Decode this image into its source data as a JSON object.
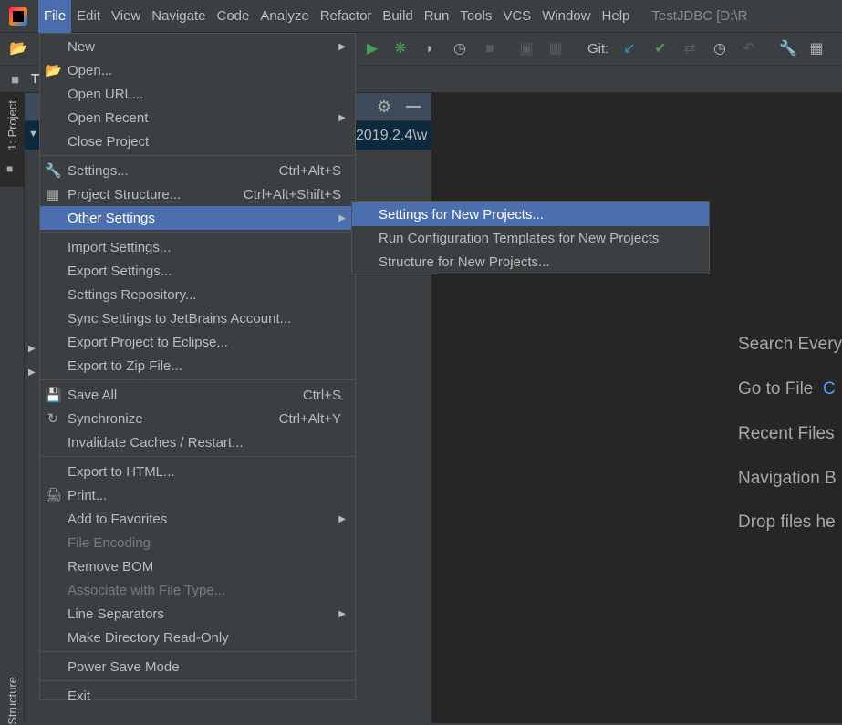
{
  "menubar": {
    "items": [
      "File",
      "Edit",
      "View",
      "Navigate",
      "Code",
      "Analyze",
      "Refactor",
      "Build",
      "Run",
      "Tools",
      "VCS",
      "Window",
      "Help"
    ],
    "active": "File",
    "window_title": "TestJDBC [D:\\R"
  },
  "toolbar": {
    "git_label": "Git:",
    "accent_green": "#499c54",
    "accent_blue": "#3592c4"
  },
  "navbar": {
    "crumb": "T"
  },
  "left_strip": {
    "project_tab": "1: Project",
    "structure_tab": "Structure"
  },
  "project_panel": {
    "path_fragment": "2019.2.4\\w"
  },
  "editor": {
    "hints": [
      "Search Every",
      "Go to File",
      "Recent Files",
      "Navigation B",
      "Drop files he"
    ],
    "goto_shortcut_fragment": "C"
  },
  "file_menu": {
    "items": [
      {
        "label": "New",
        "submenu": true
      },
      {
        "label": "Open...",
        "icon": "folder-open-icon"
      },
      {
        "label": "Open URL..."
      },
      {
        "label": "Open Recent",
        "submenu": true
      },
      {
        "label": "Close Project"
      },
      {
        "sep": true
      },
      {
        "label": "Settings...",
        "icon": "wrench-icon",
        "shortcut": "Ctrl+Alt+S"
      },
      {
        "label": "Project Structure...",
        "icon": "project-structure-icon",
        "shortcut": "Ctrl+Alt+Shift+S"
      },
      {
        "label": "Other Settings",
        "submenu": true,
        "highlighted": true
      },
      {
        "sep": true
      },
      {
        "label": "Import Settings..."
      },
      {
        "label": "Export Settings..."
      },
      {
        "label": "Settings Repository..."
      },
      {
        "label": "Sync Settings to JetBrains Account..."
      },
      {
        "label": "Export Project to Eclipse..."
      },
      {
        "label": "Export to Zip File..."
      },
      {
        "sep": true
      },
      {
        "label": "Save All",
        "icon": "save-icon",
        "shortcut": "Ctrl+S"
      },
      {
        "label": "Synchronize",
        "icon": "sync-icon",
        "shortcut": "Ctrl+Alt+Y"
      },
      {
        "label": "Invalidate Caches / Restart..."
      },
      {
        "sep": true
      },
      {
        "label": "Export to HTML..."
      },
      {
        "label": "Print...",
        "icon": "print-icon"
      },
      {
        "label": "Add to Favorites",
        "submenu": true
      },
      {
        "label": "File Encoding",
        "disabled": true
      },
      {
        "label": "Remove BOM"
      },
      {
        "label": "Associate with File Type...",
        "disabled": true
      },
      {
        "label": "Line Separators",
        "submenu": true
      },
      {
        "label": "Make Directory Read-Only"
      },
      {
        "sep": true
      },
      {
        "label": "Power Save Mode"
      },
      {
        "sep": true
      },
      {
        "label": "Exit"
      }
    ]
  },
  "other_settings_submenu": {
    "items": [
      {
        "label": "Settings for New Projects...",
        "highlighted": true
      },
      {
        "label": "Run Configuration Templates for New Projects"
      },
      {
        "label": "Structure for New Projects..."
      }
    ]
  }
}
